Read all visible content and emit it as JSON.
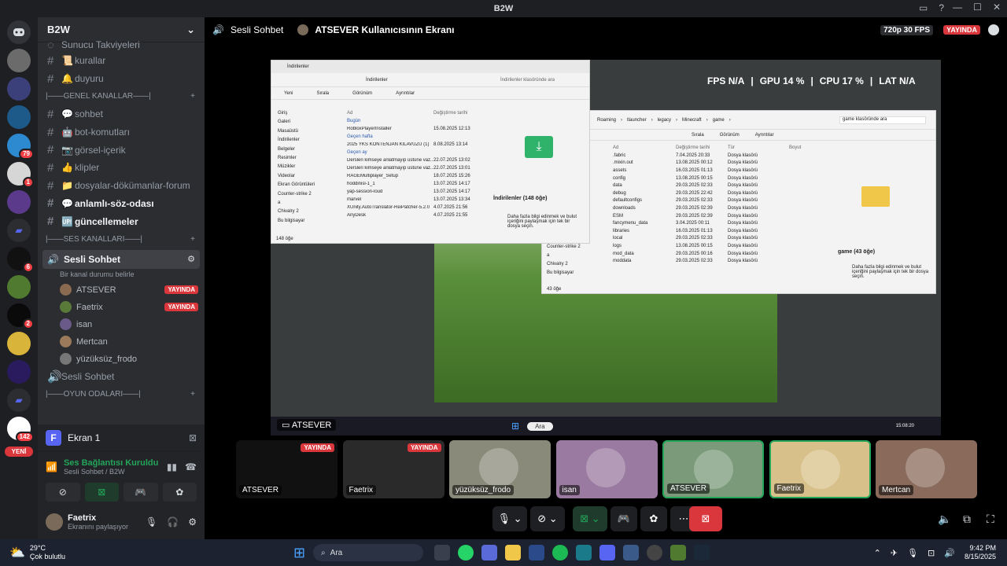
{
  "app": {
    "title": "B2W"
  },
  "titlebar_icons": [
    "inbox-icon",
    "help-icon"
  ],
  "server": {
    "name": "B2W",
    "top_item": "Sunucu Takviyeleri"
  },
  "channels": [
    {
      "type": "text",
      "name": "kurallar",
      "emoji": "📜"
    },
    {
      "type": "text",
      "name": "duyuru",
      "emoji": "🔔"
    },
    {
      "type": "category",
      "name": "|——GENEL KANALLAR——|"
    },
    {
      "type": "text",
      "name": "sohbet",
      "emoji": "💬"
    },
    {
      "type": "text",
      "name": "bot-komutları",
      "emoji": "🤖"
    },
    {
      "type": "text",
      "name": "görsel-içerik",
      "emoji": "📷"
    },
    {
      "type": "text",
      "name": "klipler",
      "emoji": "👍"
    },
    {
      "type": "text",
      "name": "dosyalar-dökümanlar-forum",
      "emoji": "📁"
    },
    {
      "type": "text",
      "name": "anlamlı-söz-odası",
      "emoji": "💬",
      "bright": true
    },
    {
      "type": "text",
      "name": "güncellemeler",
      "emoji": "🆙",
      "bright": true
    },
    {
      "type": "category",
      "name": "|——SES KANALLARI——|"
    }
  ],
  "active_voice": {
    "name": "Sesli Sohbet",
    "status": "Bir kanal durumu belirle"
  },
  "voice_members": [
    {
      "name": "ATSEVER",
      "live": "YAYINDA"
    },
    {
      "name": "Faetrix",
      "live": "YAYINDA"
    },
    {
      "name": "isan"
    },
    {
      "name": "Mertcan"
    },
    {
      "name": "yüzüksüz_frodo"
    }
  ],
  "voice2": {
    "name": "Sesli Sohbet"
  },
  "category3": {
    "name": "|——OYUN ODALARI——|"
  },
  "panel": {
    "screen_label": "Ekran 1",
    "connection": "Ses Bağlantısı Kuruldu",
    "connection_sub": "Sesli Sohbet / B2W",
    "user": "Faetrix",
    "user_status": "Ekranını paylaşıyor"
  },
  "guild_badges": [
    "79",
    "1",
    "6",
    "2",
    "142"
  ],
  "new_label": "YENİ",
  "video_header": {
    "channel": "Sesli Sohbet",
    "stream_title": "ATSEVER Kullanıcısının Ekranı",
    "quality": "720p 30 FPS",
    "live": "YAYINDA"
  },
  "overlay": {
    "fps_label": "FPS",
    "fps": "N/A",
    "gpu_label": "GPU",
    "gpu": "14 %",
    "cpu_label": "CPU",
    "cpu": "17 %",
    "lat_label": "LAT",
    "lat": "N/A"
  },
  "stream_label": "ATSEVER",
  "explorer1": {
    "title": "İndirilenler",
    "search": "İndirilenler klasöründe ara",
    "toolbar": [
      "Yeni",
      "Sırala",
      "Görünüm",
      "Ayrıntılar"
    ],
    "col_name": "Ad",
    "col_date": "Değiştirme tarihi",
    "nav": [
      "Giriş",
      "Galeri",
      "Masaüstü",
      "İndirilenler",
      "Belgeler",
      "Resimler",
      "Müzikler",
      "Videolar",
      "Ekran Görüntüleri",
      "Counter-strike 2",
      "a",
      "Chivalry 2",
      "Bu bilgisayar"
    ],
    "groups": [
      {
        "name": "Bugün",
        "files": [
          {
            "n": "RobloxPlayerInstaller",
            "d": "15.08.2025 12:13"
          }
        ]
      },
      {
        "name": "Geçen hafta",
        "files": [
          {
            "n": "2025 YKS KONTENJAN KILAVUZU (1)",
            "d": "8.08.2025 13:14"
          }
        ]
      },
      {
        "name": "Geçen ay",
        "files": [
          {
            "n": "Dersleri kimseye anlatmayıp üstüne vaz...",
            "d": "22.07.2025 13:02"
          },
          {
            "n": "Dersleri kimseye anlatmayıp üstüne vaz...",
            "d": "22.07.2025 13:01"
          },
          {
            "n": "RAGEMultiplayer_Setup",
            "d": "18.07.2025 15:26"
          },
          {
            "n": "hoddinisl-1_1",
            "d": "13.07.2025 14:17"
          },
          {
            "n": "yap-session-loud",
            "d": "13.07.2025 14:17"
          },
          {
            "n": "marvel",
            "d": "13.07.2025 13:34"
          },
          {
            "n": "XUnity.AutoTranslator-ReiPatcher-5.2.0",
            "d": "4.07.2025 21:56"
          },
          {
            "n": "AnyDesk",
            "d": "4.07.2025 21:55"
          }
        ]
      }
    ],
    "detail_title": "İndirilenler (148 öğe)",
    "detail_text": "Daha fazla bilgi edinmek ve bulut içeriğini paylaşmak için tek bir dosya seçin.",
    "count": "148 öğe"
  },
  "explorer2": {
    "path": [
      "Roaming",
      "tlauncher",
      "legacy",
      "Minecraft",
      "game"
    ],
    "search": "game klasöründe ara",
    "toolbar": [
      "Sırala",
      "Görünüm",
      "Ayrıntılar"
    ],
    "cols": [
      "Ad",
      "Değiştirme tarihi",
      "Tür",
      "Boyut"
    ],
    "nav": [
      "Counter-strike 2",
      "a",
      "Chivalry 2",
      "Bu bilgisayar"
    ],
    "files": [
      {
        "n": ".fabric",
        "d": "7.04.2025 20:33",
        "t": "Dosya klasörü"
      },
      {
        "n": ".mixin.out",
        "d": "13.08.2025 00:12",
        "t": "Dosya klasörü"
      },
      {
        "n": "assets",
        "d": "16.03.2025 01:13",
        "t": "Dosya klasörü"
      },
      {
        "n": "config",
        "d": "13.08.2025 00:15",
        "t": "Dosya klasörü"
      },
      {
        "n": "data",
        "d": "29.03.2025 02:33",
        "t": "Dosya klasörü"
      },
      {
        "n": "debug",
        "d": "29.03.2025 22:42",
        "t": "Dosya klasörü"
      },
      {
        "n": "defaultconfigs",
        "d": "29.03.2025 02:33",
        "t": "Dosya klasörü"
      },
      {
        "n": "downloads",
        "d": "29.03.2025 02:39",
        "t": "Dosya klasörü"
      },
      {
        "n": "ESM",
        "d": "29.03.2025 02:39",
        "t": "Dosya klasörü"
      },
      {
        "n": "fancymenu_data",
        "d": "3.04.2025 00:11",
        "t": "Dosya klasörü"
      },
      {
        "n": "libraries",
        "d": "16.03.2025 01:13",
        "t": "Dosya klasörü"
      },
      {
        "n": "local",
        "d": "29.03.2025 02:33",
        "t": "Dosya klasörü"
      },
      {
        "n": "logs",
        "d": "13.08.2025 00:15",
        "t": "Dosya klasörü"
      },
      {
        "n": "mod_data",
        "d": "29.03.2025 00:16",
        "t": "Dosya klasörü"
      },
      {
        "n": "moddata",
        "d": "29.03.2025 02:33",
        "t": "Dosya klasörü"
      }
    ],
    "detail_title": "game (43 öğe)",
    "detail_text": "Daha fazla bilgi edinmek ve bulut içeriğini paylaşmak için tek bir dosya seçin.",
    "count": "43 öğe"
  },
  "tiles": [
    {
      "name": "ATSEVER",
      "live": "YAYINDA"
    },
    {
      "name": "Faetrix",
      "live": "YAYINDA"
    },
    {
      "name": "yüzüksüz_frodo"
    },
    {
      "name": "isan"
    },
    {
      "name": "ATSEVER"
    },
    {
      "name": "Faetrix"
    },
    {
      "name": "Mertcan"
    }
  ],
  "stream_taskbar_search": "Ara",
  "stream_time": "15:08:20",
  "taskbar": {
    "weather_temp": "29°C",
    "weather_text": "Çok bulutlu",
    "search": "Ara",
    "time": "9:42 PM",
    "date": "8/15/2025"
  },
  "colors": {
    "accent": "#5865f2",
    "live": "#da373c",
    "green": "#23a55a",
    "bg": "#2b2d31"
  }
}
